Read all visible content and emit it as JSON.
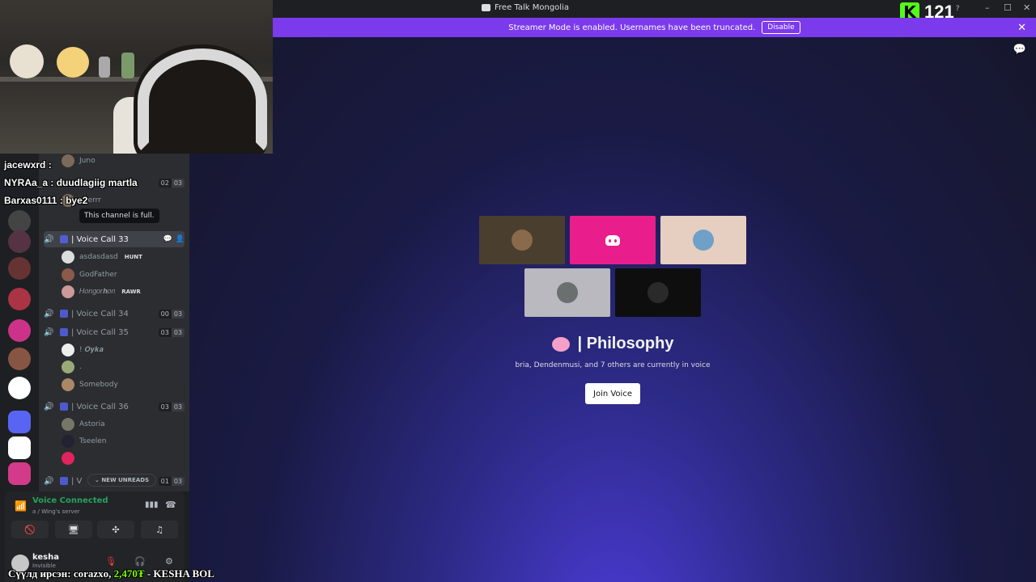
{
  "window": {
    "title": "Free Talk Mongolia",
    "minimize": "–",
    "maximize": "☐",
    "close": "✕"
  },
  "kick_overlay": {
    "letter": "K",
    "viewers": "121",
    "help": "?"
  },
  "streamer_banner": {
    "text": "Streamer Mode is enabled. Usernames have been truncated.",
    "button": "Disable",
    "close": "✕"
  },
  "chat_overlay": [
    "jacewxrd :",
    "NYRAa_a : duudlagiig martla",
    "Barxas0111 : bye2"
  ],
  "channels": {
    "partial_top": [
      "Juno",
      "ellerrr"
    ],
    "tooltip": "This channel is full.",
    "voice_calls": [
      {
        "label": "| Voice Call 33",
        "active": true
      },
      {
        "label": "| Voice Call 34",
        "count_a": "00",
        "count_b": "03"
      },
      {
        "label": "| Voice Call 35",
        "count_a": "03",
        "count_b": "03"
      },
      {
        "label": "| Voice Call 36",
        "count_a": "03",
        "count_b": "03"
      },
      {
        "label": "| V",
        "count_a": "01",
        "count_b": "03"
      }
    ],
    "top_counts": {
      "a": "02",
      "b": "03"
    },
    "members_33": [
      {
        "name": "asdasdasd",
        "tag": "HUNT"
      },
      {
        "name": "GodFather"
      },
      {
        "name": "𝐻𝑜𝑛𝑔𝑜𝑟𝒉𝑜𝑛",
        "tag": "RAWR"
      }
    ],
    "members_35": [
      {
        "name": "! 𝑶𝒚𝒌𝒂"
      },
      {
        "name": "."
      },
      {
        "name": "Somebody"
      }
    ],
    "members_36": [
      {
        "name": "Astoria"
      },
      {
        "name": "Tseelen"
      },
      {
        "name": ""
      }
    ],
    "new_unreads": "NEW UNREADS"
  },
  "voice_panel": {
    "status": "Voice Connected",
    "server": "a / Wing's server"
  },
  "user_panel": {
    "name": "kesha",
    "status": "Invisible"
  },
  "ticker": {
    "prefix": "Сүүлд ирсэн: corazxo,",
    "amount": "2,470₮",
    "suffix": "- KESHA BOL"
  },
  "main": {
    "channel_name": "| Philosophy",
    "subtitle": "bria, Dendenmusi, and 7 others are currently in voice",
    "join_button": "Join Voice",
    "tiles": [
      {
        "bg": "#4a3f2e",
        "avatar": "#8a6a4a"
      },
      {
        "bg": "#e91e8c",
        "discord": true
      },
      {
        "bg": "#e6cfc0",
        "avatar": "#6fa0c8"
      },
      {
        "bg": "#b9b9bf",
        "avatar": "#6a7070"
      },
      {
        "bg": "#0e0e0e",
        "avatar": "#2a2a2a"
      }
    ]
  },
  "colors": {
    "accent": "#5865f2",
    "banner": "#7c3aed",
    "connected": "#23a55a"
  }
}
